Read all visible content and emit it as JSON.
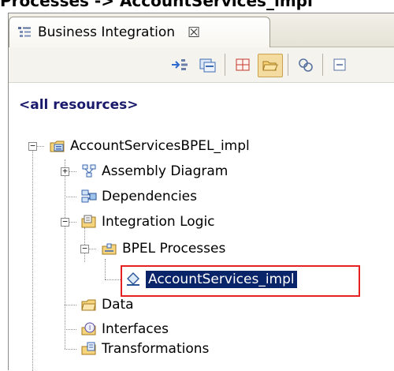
{
  "heading": "Processes -> AccountServices_impl",
  "view": {
    "tab_label": "Business Integration",
    "tab_close": "☒"
  },
  "toolbar": {
    "buttons": [
      {
        "icon": "link-with-editor-icon"
      },
      {
        "icon": "show-categories-icon"
      },
      {
        "icon": "show-grid-icon",
        "pressed": false
      },
      {
        "icon": "show-folders-icon",
        "pressed": true
      },
      {
        "icon": "refresh-icon"
      },
      {
        "icon": "collapse-all-icon"
      }
    ]
  },
  "tree": {
    "root_label": "<all resources>",
    "project": {
      "label": "AccountServicesBPEL_impl",
      "expanded": true
    },
    "items": {
      "assembly": "Assembly Diagram",
      "dependencies": "Dependencies",
      "integration_logic": "Integration Logic",
      "bpel_processes": "BPEL Processes",
      "account_services_impl": "AccountServices_impl",
      "data": "Data",
      "interfaces": "Interfaces",
      "transformations": "Transformations"
    },
    "selected": "AccountServices_impl"
  },
  "colors": {
    "selection": "#0a246a",
    "highlight_box": "#e52121",
    "root_link": "#1a1a6c"
  }
}
